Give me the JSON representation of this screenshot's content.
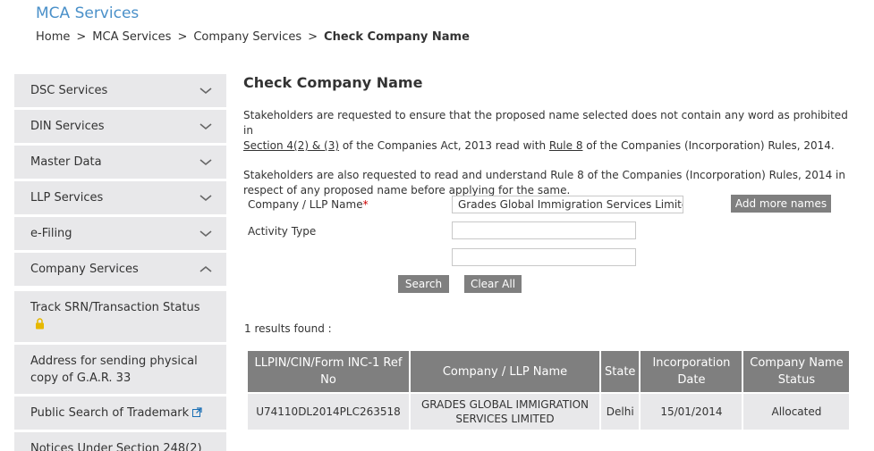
{
  "header": {
    "site_title": "MCA Services",
    "breadcrumb": [
      "Home",
      "MCA Services",
      "Company Services"
    ],
    "breadcrumb_current": "Check Company Name",
    "separator": ">"
  },
  "sidebar": {
    "items": [
      {
        "label": "DSC Services",
        "expanded": false
      },
      {
        "label": "DIN Services",
        "expanded": false
      },
      {
        "label": "Master Data",
        "expanded": false
      },
      {
        "label": "LLP Services",
        "expanded": false
      },
      {
        "label": "e-Filing",
        "expanded": false
      },
      {
        "label": "Company Services",
        "expanded": true
      }
    ],
    "subitems": [
      {
        "label": "Track SRN/Transaction Status",
        "icon": "lock-icon"
      },
      {
        "label": "Address for sending physical copy of G.A.R. 33",
        "icon": ""
      },
      {
        "label": "Public Search of Trademark",
        "icon": "external-link-icon"
      },
      {
        "label": "Notices Under Section 248(2)",
        "icon": ""
      }
    ]
  },
  "main": {
    "title": "Check Company Name",
    "para1_a": "Stakeholders are requested to ensure that the proposed name selected does not contain any word as prohibited in",
    "para1_link1": "Section 4(2) & (3)",
    "para1_b": " of the Companies Act, 2013 read with ",
    "para1_link2": "Rule 8",
    "para1_c": " of the Companies (Incorporation) Rules, 2014.",
    "para2": "Stakeholders are also requested to read and understand Rule 8 of the Companies (Incorporation) Rules, 2014 in respect of any proposed name before applying for the same.",
    "form": {
      "company_label": "Company / LLP Name",
      "required_mark": "*",
      "company_value": "Grades Global Immigration Services Limited",
      "add_more_label": "Add more names",
      "activity_label": "Activity Type",
      "activity_value": "",
      "activity_value2": "",
      "search_label": "Search",
      "clear_label": "Clear All"
    },
    "results_count": "1 results found :",
    "table": {
      "headers": [
        "LLPIN/CIN/Form INC-1 Ref No",
        "Company / LLP Name",
        "State",
        "Incorporation Date",
        "Company Name Status"
      ],
      "rows": [
        [
          "U74110DL2014PLC263518",
          "GRADES GLOBAL IMMIGRATION SERVICES LIMITED",
          "Delhi",
          "15/01/2014",
          "Allocated"
        ]
      ]
    }
  },
  "colors": {
    "title_blue": "#4a90c9",
    "sidebar_bg": "#e8e8ea",
    "button_gray": "#7f7f7f",
    "required_red": "#cc0000",
    "lock_yellow": "#e6b800",
    "link_blue": "#1a6fb5"
  }
}
